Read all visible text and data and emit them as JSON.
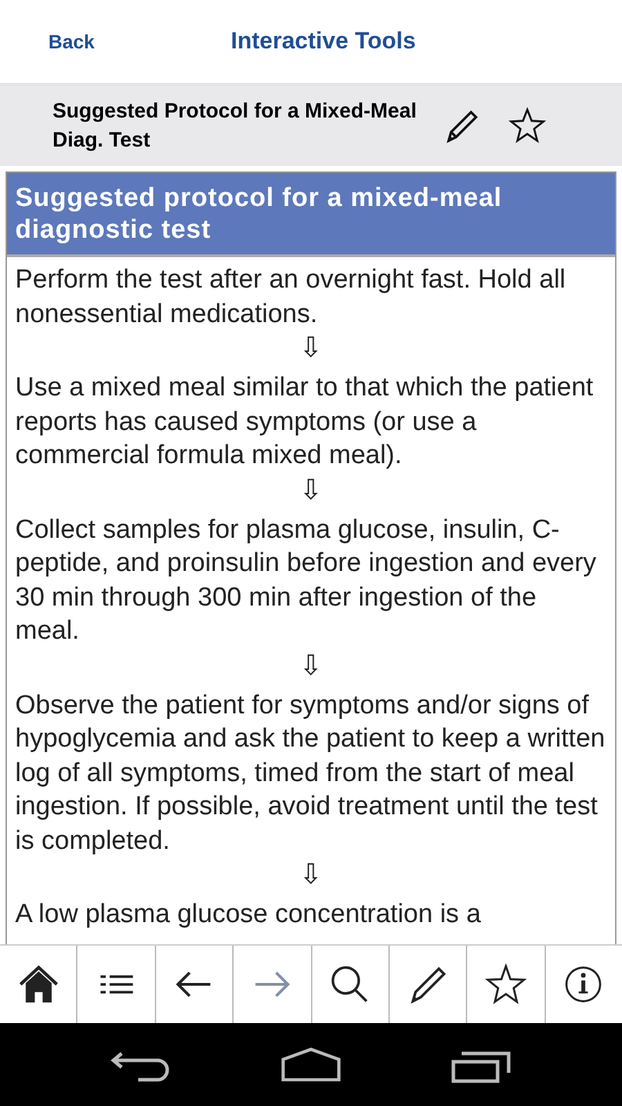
{
  "header": {
    "back": "Back",
    "title": "Interactive Tools"
  },
  "subheader": {
    "title": "Suggested Protocol for a Mixed-Meal Diag. Test"
  },
  "content": {
    "heading": "Suggested protocol for a mixed-meal diagnostic test",
    "blocks": [
      {
        "kind": "text",
        "text": "Perform the test after an overnight fast. Hold all nonessential medications."
      },
      {
        "kind": "arrow",
        "text": "⇩"
      },
      {
        "kind": "text",
        "text": "Use a mixed meal similar to that which the patient reports has caused symptoms (or use a commercial formula mixed meal)."
      },
      {
        "kind": "arrow",
        "text": "⇩"
      },
      {
        "kind": "text",
        "text": "Collect samples for plasma glucose, insulin, C-peptide, and proinsulin before ingestion and every 30 min through 300 min after ingestion of the meal."
      },
      {
        "kind": "arrow",
        "text": "⇩"
      },
      {
        "kind": "text",
        "text": "Observe the patient for symptoms and/or signs of hypoglycemia and ask the patient to keep a written log of all symptoms, timed from the start of meal ingestion. If possible, avoid treatment until the test is completed."
      },
      {
        "kind": "arrow",
        "text": "⇩"
      },
      {
        "kind": "text",
        "text": "A low plasma glucose concentration is a"
      }
    ]
  },
  "toolbar": [
    {
      "kind": "home",
      "disabled": false
    },
    {
      "kind": "list",
      "disabled": false
    },
    {
      "kind": "back",
      "disabled": false
    },
    {
      "kind": "forward",
      "disabled": true
    },
    {
      "kind": "search",
      "disabled": false
    },
    {
      "kind": "edit",
      "disabled": false
    },
    {
      "kind": "star",
      "disabled": false
    },
    {
      "kind": "info",
      "disabled": false
    }
  ]
}
